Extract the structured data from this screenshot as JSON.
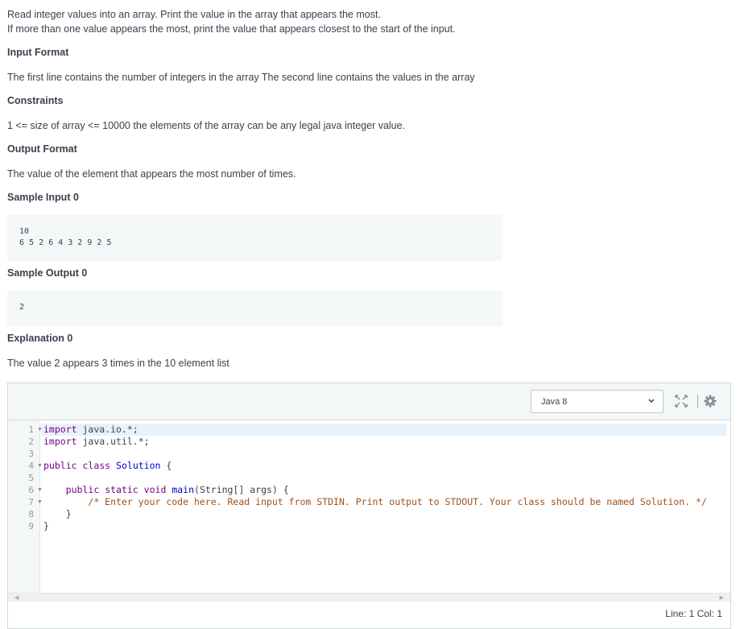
{
  "problem": {
    "intro_line1": "Read integer values into an array. Print the value in the array that appears the most.",
    "intro_line2": "If more than one value appears the most, print the value that appears closest to the start of the input.",
    "input_format_heading": "Input Format",
    "input_format_text": "The first line contains the number of integers in the array The second line contains the values in the array",
    "constraints_heading": "Constraints",
    "constraints_text": "1 <= size of array <= 10000 the elements of the array can be any legal java integer value.",
    "output_format_heading": "Output Format",
    "output_format_text": "The value of the element that appears the most number of times.",
    "sample_input_heading": "Sample Input 0",
    "sample_input_line1": "10",
    "sample_input_line2": "6 5 2 6 4 3 2 9 2 5",
    "sample_output_heading": "Sample Output 0",
    "sample_output_line1": "2",
    "explanation_heading": "Explanation 0",
    "explanation_text": "The value 2 appears 3 times in the 10 element list"
  },
  "editor": {
    "language": "Java 8",
    "icons": {
      "expand": "expand-icon",
      "settings": "gear-icon",
      "dropdown": "chevron-down-icon"
    },
    "line_numbers": [
      "1",
      "2",
      "3",
      "4",
      "5",
      "6",
      "7",
      "8",
      "9"
    ],
    "code": {
      "l1_kw": "import",
      "l1_rest": " java.io.*;",
      "l2_kw": "import",
      "l2_rest": " java.util.*;",
      "l4_kw1": "public",
      "l4_kw2": "class",
      "l4_name": "Solution",
      "l4_rest": " {",
      "l6_kw1": "public",
      "l6_kw2": "static",
      "l6_kw3": "void",
      "l6_name": "main",
      "l6_rest": "(String[] args) {",
      "l7_comment": "/* Enter your code here. Read input from STDIN. Print output to STDOUT. Your class should be named Solution. */",
      "l8": "    }",
      "l9": "}"
    },
    "status": "Line: 1 Col: 1"
  }
}
